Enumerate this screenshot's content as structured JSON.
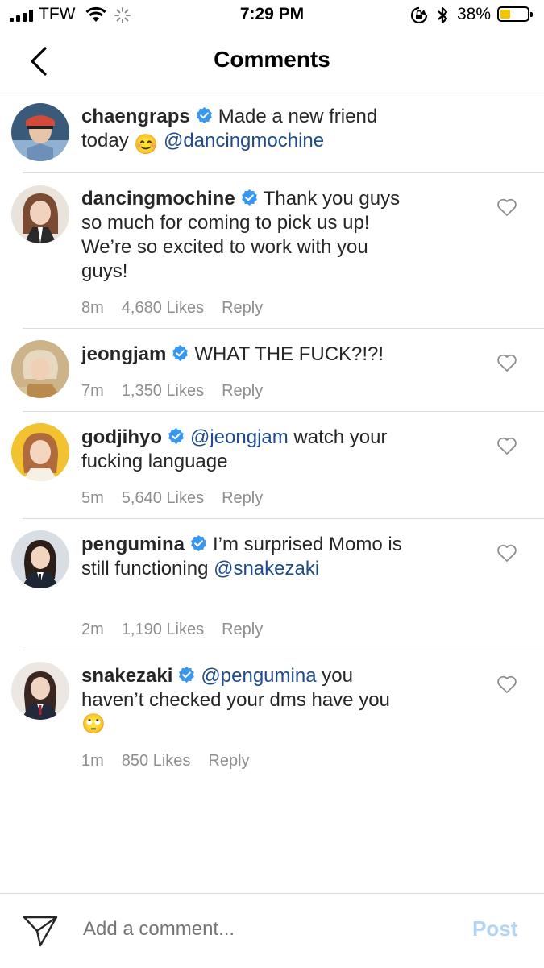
{
  "status_bar": {
    "carrier": "TFW",
    "time": "7:29 PM",
    "battery": "38%",
    "battery_level": 0.38
  },
  "header": {
    "title": "Comments"
  },
  "comments": [
    {
      "username": "chaengraps",
      "text_parts": [
        "Made a new friend today ",
        "😊",
        " ",
        "@dancingmochine"
      ]
    },
    {
      "username": "dancingmochine",
      "text": "Thank you guys so much for coming to pick us up! We’re so excited to work with you guys!",
      "time": "8m",
      "likes": "4,680 Likes",
      "reply": "Reply"
    },
    {
      "username": "jeongjam",
      "text": "WHAT THE FUCK?!?!",
      "time": "7m",
      "likes": "1,350 Likes",
      "reply": "Reply"
    },
    {
      "username": "godjihyo",
      "mention": "@jeongjam",
      "text": " watch your fucking language",
      "time": "5m",
      "likes": "5,640 Likes",
      "reply": "Reply"
    },
    {
      "username": "pengumina",
      "text": "I’m surprised Momo is still functioning ",
      "mention": "@snakezaki",
      "time": "2m",
      "likes": "1,190 Likes",
      "reply": "Reply"
    },
    {
      "username": "snakezaki",
      "mention": "@pengumina",
      "text": " you haven’t checked your dms have you ",
      "emoji": "🙄",
      "time": "1m",
      "likes": "850 Likes",
      "reply": "Reply"
    }
  ],
  "footer": {
    "placeholder": "Add a comment...",
    "post_label": "Post"
  },
  "colors": {
    "mention": "#1e4b8c",
    "verified": "#3897f0",
    "post_disabled": "#b3d4f5",
    "meta": "#8e8e8e",
    "battery": "#f5c400"
  },
  "icons": [
    "back-chevron-icon",
    "verified-badge-icon",
    "heart-outline-icon",
    "send-direct-icon",
    "wifi-icon",
    "bluetooth-icon",
    "rotation-lock-icon"
  ]
}
